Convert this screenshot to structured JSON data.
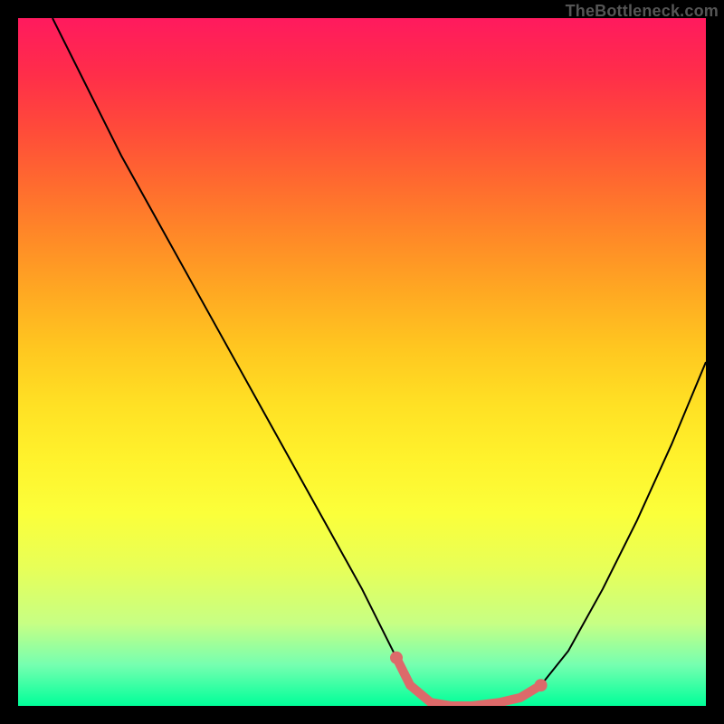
{
  "attribution": "TheBottleneck.com",
  "chart_data": {
    "type": "line",
    "title": "",
    "xlabel": "",
    "ylabel": "",
    "xlim": [
      0,
      100
    ],
    "ylim": [
      0,
      100
    ],
    "series": [
      {
        "name": "curve",
        "x": [
          5,
          10,
          15,
          20,
          25,
          30,
          35,
          40,
          45,
          50,
          55,
          57,
          60,
          63,
          66,
          70,
          73,
          76,
          80,
          85,
          90,
          95,
          100
        ],
        "values": [
          100,
          90,
          80,
          71,
          62,
          53,
          44,
          35,
          26,
          17,
          7,
          3,
          0.5,
          0,
          0,
          0.5,
          1.2,
          3,
          8,
          17,
          27,
          38,
          50
        ]
      },
      {
        "name": "highlight",
        "x": [
          55,
          57,
          60,
          63,
          66,
          70,
          73,
          76
        ],
        "values": [
          7,
          3,
          0.5,
          0,
          0,
          0.5,
          1.2,
          3
        ]
      }
    ],
    "highlight_endpoints": [
      {
        "x": 55,
        "y": 7
      },
      {
        "x": 76,
        "y": 3
      }
    ],
    "colors": {
      "curve": "#000000",
      "highlight": "#dd6a6a"
    }
  }
}
